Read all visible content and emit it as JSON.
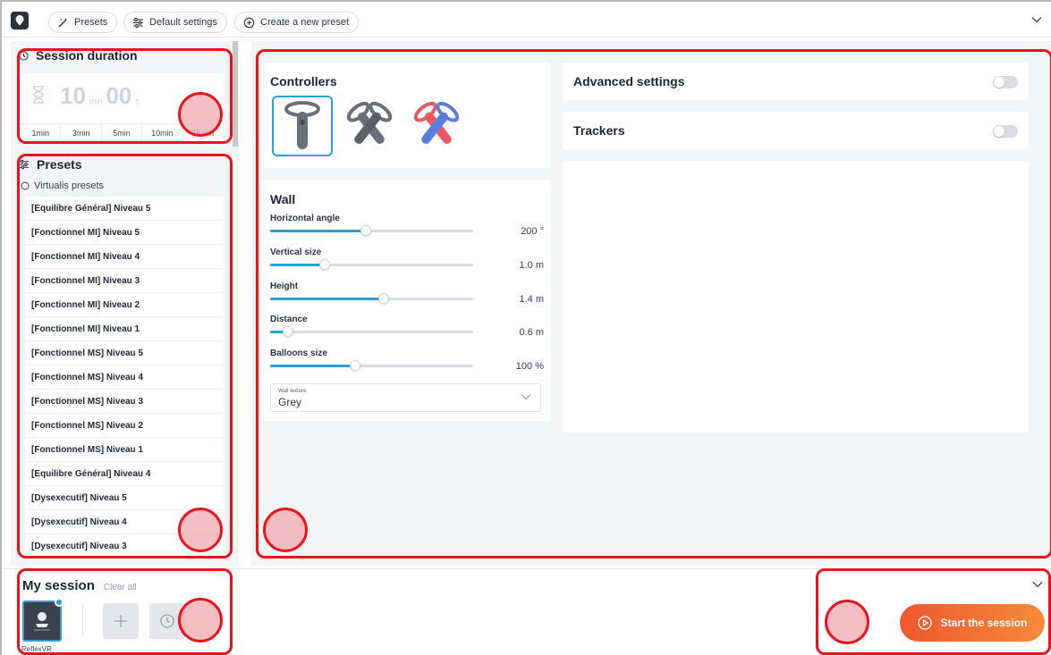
{
  "topbar": {
    "tabs": [
      {
        "label": "Presets",
        "icon": "magic-wand-icon"
      },
      {
        "label": "Default settings",
        "icon": "sliders-icon"
      },
      {
        "label": "Create a new preset",
        "icon": "plus-circle-icon"
      }
    ]
  },
  "session_duration": {
    "title": "Session duration",
    "minutes": "10",
    "minutes_unit": "min",
    "seconds": "00",
    "seconds_unit": "s",
    "quick_options": [
      "1min",
      "3min",
      "5min",
      "10min",
      "15min"
    ]
  },
  "presets": {
    "title": "Presets",
    "group": "Virtualis presets",
    "items": [
      "[Equilibre Général] Niveau 5",
      "[Fonctionnel MI] Niveau 5",
      "[Fonctionnel MI] Niveau 4",
      "[Fonctionnel MI] Niveau 3",
      "[Fonctionnel MI] Niveau 2",
      "[Fonctionnel MI] Niveau 1",
      "[Fonctionnel MS] Niveau 5",
      "[Fonctionnel MS] Niveau 4",
      "[Fonctionnel MS] Niveau 3",
      "[Fonctionnel MS] Niveau 2",
      "[Fonctionnel MS] Niveau 1",
      "[Equilibre Général] Niveau 4",
      "[Dysexecutif] Niveau 5",
      "[Dysexecutif] Niveau 4",
      "[Dysexecutif] Niveau 3"
    ]
  },
  "controllers": {
    "title": "Controllers",
    "options": [
      {
        "name": "single-controller",
        "color": "#6b6f78",
        "selected": true
      },
      {
        "name": "dual-controllers-grey",
        "color": "#6b6f78",
        "selected": false
      },
      {
        "name": "dual-controllers-color",
        "color": "#e85a63",
        "selected": false
      }
    ]
  },
  "wall": {
    "title": "Wall",
    "sliders": [
      {
        "label": "Horizontal angle",
        "value": "200 °",
        "fraction": 0.47
      },
      {
        "label": "Vertical size",
        "value": "1.0 m",
        "fraction": 0.27
      },
      {
        "label": "Height",
        "value": "1.4 m",
        "fraction": 0.56
      },
      {
        "label": "Distance",
        "value": "0.6 m",
        "fraction": 0.09
      },
      {
        "label": "Balloons size",
        "value": "100 %",
        "fraction": 0.42
      }
    ],
    "texture": {
      "label": "Wall texture",
      "value": "Grey"
    }
  },
  "advanced_settings": {
    "title": "Advanced settings",
    "enabled": false
  },
  "trackers": {
    "title": "Trackers",
    "enabled": false
  },
  "my_session": {
    "title": "My session",
    "clear_label": "Clear all",
    "item_label": "ReflexVR"
  },
  "start_button": {
    "label": "Start the session"
  },
  "colors": {
    "accent": "#2a9fd8",
    "start_gradient_from": "#f0582f",
    "start_gradient_to": "#f58a3a",
    "annotation": "#e8141e"
  }
}
